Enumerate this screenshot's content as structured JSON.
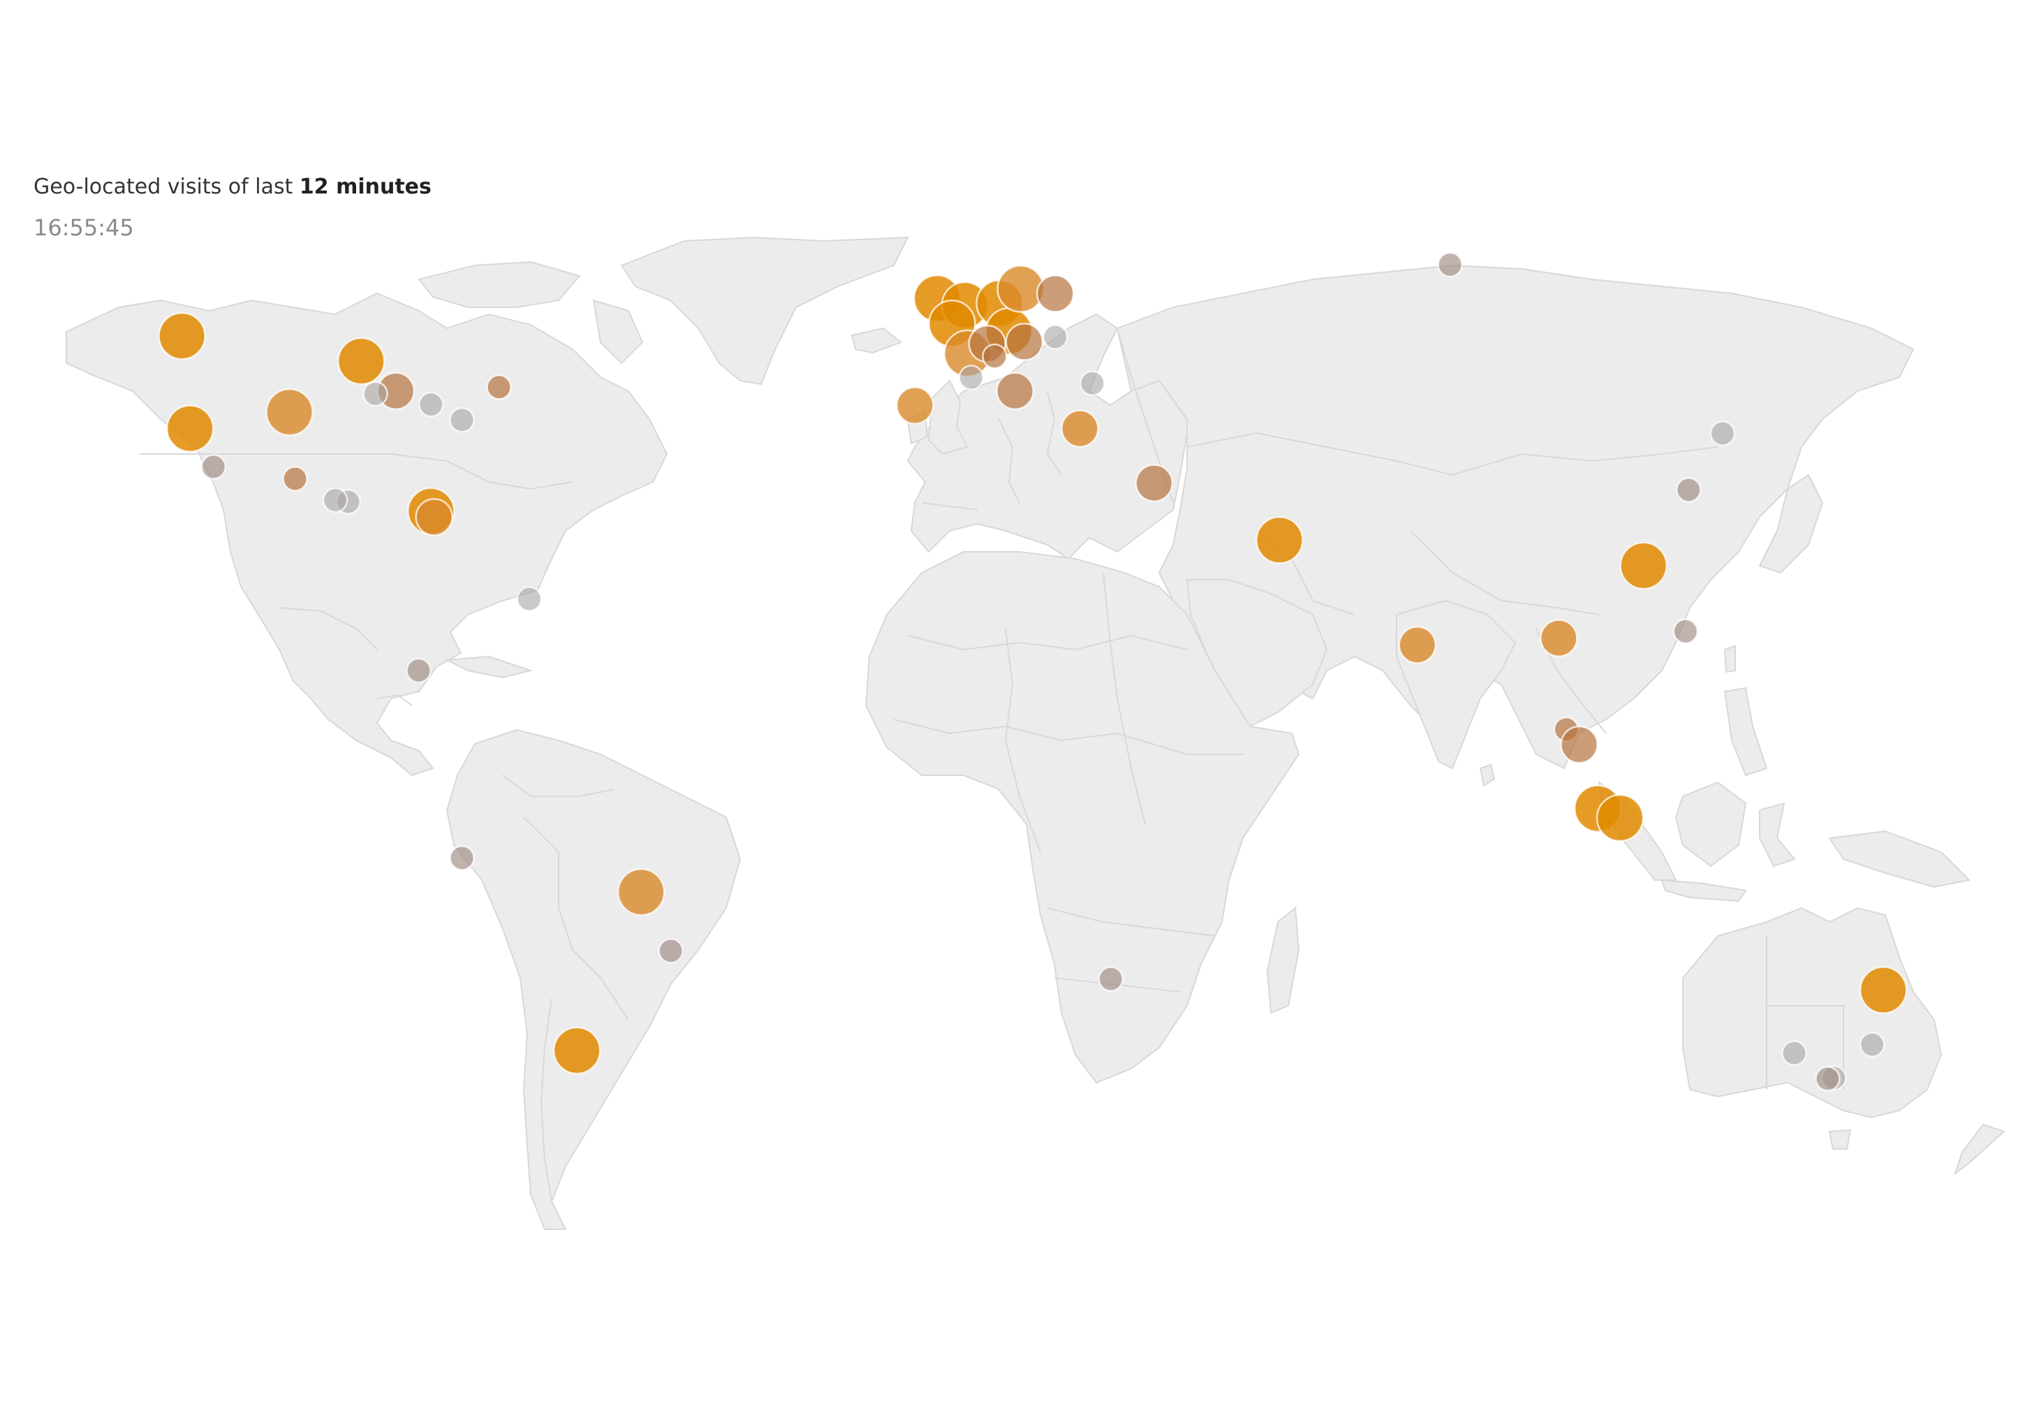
{
  "widget": {
    "caption_prefix": "Geo-located visits of last ",
    "caption_bold": "12 minutes",
    "time": "16:55:45"
  },
  "map": {
    "land_color": "#ececec",
    "border_color": "#d8d8d8",
    "visit_colors": {
      "fresh": "#e08a00",
      "recent": "#d9892b",
      "older": "#b5733f",
      "faded": "#9e8a82",
      "stale": "#a9a4a4"
    },
    "visits": [
      {
        "region": "Seattle",
        "lon": -122.3,
        "lat": 47.6,
        "size": 3,
        "age": "fresh"
      },
      {
        "region": "California",
        "lon": -121.0,
        "lat": 38.0,
        "size": 3,
        "age": "fresh"
      },
      {
        "region": "Los Angeles",
        "lon": -117.2,
        "lat": 33.9,
        "size": 1,
        "age": "faded"
      },
      {
        "region": "Minneapolis",
        "lon": -93.3,
        "lat": 45.0,
        "size": 3,
        "age": "fresh"
      },
      {
        "region": "Chicago",
        "lon": -87.7,
        "lat": 41.9,
        "size": 2,
        "age": "older"
      },
      {
        "region": "Iowa",
        "lon": -91.0,
        "lat": 41.6,
        "size": 1,
        "age": "stale"
      },
      {
        "region": "Denver",
        "lon": -104.9,
        "lat": 39.7,
        "size": 3,
        "age": "recent"
      },
      {
        "region": "Texas",
        "lon": -104.0,
        "lat": 32.5,
        "size": 1,
        "age": "older"
      },
      {
        "region": "Houston",
        "lon": -95.4,
        "lat": 29.8,
        "size": 1,
        "age": "stale"
      },
      {
        "region": "Houston-2",
        "lon": -97.5,
        "lat": 30.0,
        "size": 1,
        "age": "stale"
      },
      {
        "region": "Florida",
        "lon": -82.0,
        "lat": 28.7,
        "size": 3,
        "age": "fresh"
      },
      {
        "region": "Florida-2",
        "lon": -81.5,
        "lat": 28.0,
        "size": 2,
        "age": "recent"
      },
      {
        "region": "Ohio",
        "lon": -82.0,
        "lat": 40.5,
        "size": 1,
        "age": "stale"
      },
      {
        "region": "Washington DC",
        "lon": -77.0,
        "lat": 38.9,
        "size": 1,
        "age": "stale"
      },
      {
        "region": "Boston",
        "lon": -71.0,
        "lat": 42.3,
        "size": 1,
        "age": "older"
      },
      {
        "region": "Puerto Rico",
        "lon": -66.1,
        "lat": 18.4,
        "size": 1,
        "age": "stale"
      },
      {
        "region": "Costa Rica",
        "lon": -84.0,
        "lat": 10.0,
        "size": 1,
        "age": "faded"
      },
      {
        "region": "Lima",
        "lon": -77.0,
        "lat": -12.0,
        "size": 1,
        "age": "faded"
      },
      {
        "region": "Brasilia",
        "lon": -48.0,
        "lat": -16.0,
        "size": 3,
        "age": "recent"
      },
      {
        "region": "Rio de Janeiro",
        "lon": -43.2,
        "lat": -22.9,
        "size": 1,
        "age": "faded"
      },
      {
        "region": "Buenos Aires",
        "lon": -58.4,
        "lat": -34.6,
        "size": 3,
        "age": "fresh"
      },
      {
        "region": "London",
        "lon": -0.1,
        "lat": 51.5,
        "size": 3,
        "age": "fresh"
      },
      {
        "region": "Belgium",
        "lon": 4.4,
        "lat": 50.8,
        "size": 3,
        "age": "fresh"
      },
      {
        "region": "Paris",
        "lon": 2.3,
        "lat": 48.9,
        "size": 3,
        "age": "fresh"
      },
      {
        "region": "Lyon",
        "lon": 4.8,
        "lat": 45.8,
        "size": 3,
        "age": "recent"
      },
      {
        "region": "Germany",
        "lon": 10.0,
        "lat": 51.0,
        "size": 3,
        "age": "fresh"
      },
      {
        "region": "Bavaria",
        "lon": 11.5,
        "lat": 48.1,
        "size": 3,
        "age": "fresh"
      },
      {
        "region": "Berlin",
        "lon": 13.4,
        "lat": 52.5,
        "size": 3,
        "age": "recent"
      },
      {
        "region": "Poland",
        "lon": 19.0,
        "lat": 52.0,
        "size": 2,
        "age": "older"
      },
      {
        "region": "Hungary",
        "lon": 19.0,
        "lat": 47.5,
        "size": 1,
        "age": "stale"
      },
      {
        "region": "Austria",
        "lon": 14.0,
        "lat": 47.0,
        "size": 2,
        "age": "older"
      },
      {
        "region": "Switzerland",
        "lon": 8.0,
        "lat": 46.8,
        "size": 2,
        "age": "older"
      },
      {
        "region": "Milan",
        "lon": 9.2,
        "lat": 45.5,
        "size": 1,
        "age": "older"
      },
      {
        "region": "Rome",
        "lon": 12.5,
        "lat": 41.9,
        "size": 2,
        "age": "older"
      },
      {
        "region": "Marseille",
        "lon": 5.4,
        "lat": 43.3,
        "size": 1,
        "age": "stale"
      },
      {
        "region": "Madrid",
        "lon": -3.7,
        "lat": 40.4,
        "size": 2,
        "age": "recent"
      },
      {
        "region": "Greece",
        "lon": 23.0,
        "lat": 38.0,
        "size": 2,
        "age": "recent"
      },
      {
        "region": "Bulgaria",
        "lon": 25.0,
        "lat": 42.7,
        "size": 1,
        "age": "stale"
      },
      {
        "region": "Israel",
        "lon": 35.0,
        "lat": 32.0,
        "size": 2,
        "age": "older"
      },
      {
        "region": "Dubai",
        "lon": 55.3,
        "lat": 25.3,
        "size": 3,
        "age": "fresh"
      },
      {
        "region": "Russia",
        "lon": 82.9,
        "lat": 55.0,
        "size": 1,
        "age": "faded"
      },
      {
        "region": "Bangalore",
        "lon": 77.6,
        "lat": 13.0,
        "size": 2,
        "age": "recent"
      },
      {
        "region": "Bangkok",
        "lon": 100.5,
        "lat": 13.8,
        "size": 2,
        "age": "recent"
      },
      {
        "region": "Shanghai",
        "lon": 121.5,
        "lat": 31.2,
        "size": 1,
        "age": "faded"
      },
      {
        "region": "Korea",
        "lon": 127.0,
        "lat": 37.5,
        "size": 1,
        "age": "stale"
      },
      {
        "region": "Hong Kong",
        "lon": 114.2,
        "lat": 22.3,
        "size": 3,
        "age": "fresh"
      },
      {
        "region": "Manila",
        "lon": 121.0,
        "lat": 14.6,
        "size": 1,
        "age": "faded"
      },
      {
        "region": "Malaysia",
        "lon": 101.7,
        "lat": 3.1,
        "size": 1,
        "age": "older"
      },
      {
        "region": "Singapore",
        "lon": 103.8,
        "lat": 1.3,
        "size": 2,
        "age": "older"
      },
      {
        "region": "Jakarta",
        "lon": 106.8,
        "lat": -6.2,
        "size": 3,
        "age": "fresh"
      },
      {
        "region": "Bali",
        "lon": 110.4,
        "lat": -7.3,
        "size": 3,
        "age": "fresh"
      },
      {
        "region": "Johannesburg",
        "lon": 28.0,
        "lat": -26.2,
        "size": 1,
        "age": "faded"
      },
      {
        "region": "Brisbane",
        "lon": 153.0,
        "lat": -27.5,
        "size": 3,
        "age": "fresh"
      },
      {
        "region": "Sydney",
        "lon": 151.2,
        "lat": -33.9,
        "size": 1,
        "age": "stale"
      },
      {
        "region": "Melbourne",
        "lon": 145.0,
        "lat": -37.8,
        "size": 1,
        "age": "stale"
      },
      {
        "region": "Melbourne-2",
        "lon": 144.0,
        "lat": -37.9,
        "size": 1,
        "age": "faded"
      },
      {
        "region": "Adelaide",
        "lon": 138.6,
        "lat": -34.9,
        "size": 1,
        "age": "stale"
      }
    ]
  }
}
